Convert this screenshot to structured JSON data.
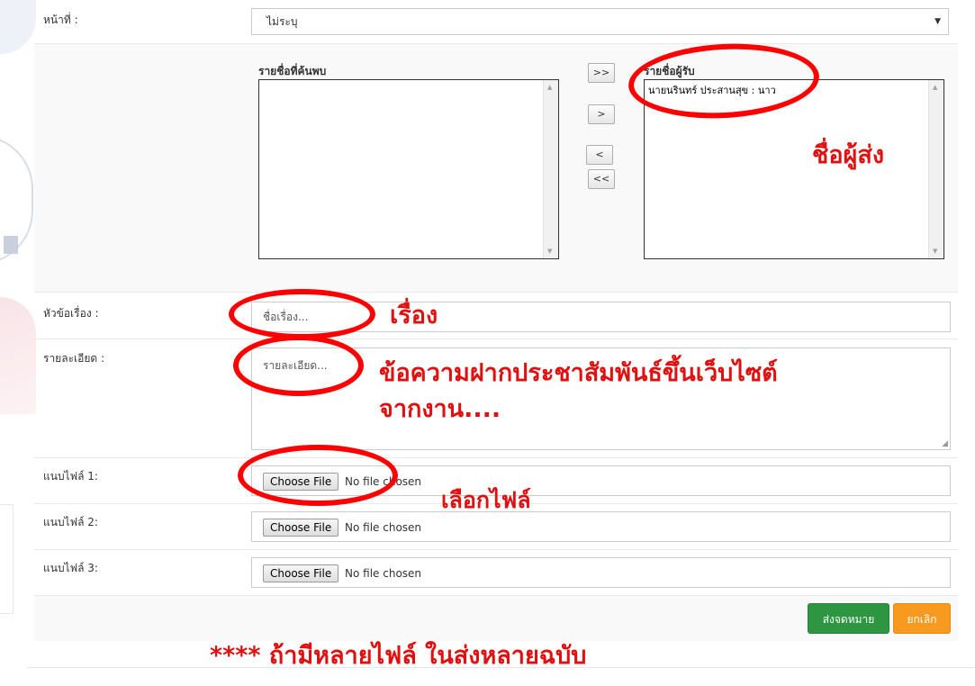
{
  "form": {
    "department_label": "หน้าที่ :",
    "department_value": "ไม่ระบุ",
    "found_list_label": "รายชื่อที่ค้นพบ",
    "found_list_items": [],
    "recipient_list_label": "รายชื่อผู้รับ",
    "recipient_list_items": [
      "นายนรินทร์ ประสานสุข : นาว"
    ],
    "move_buttons": [
      ">>",
      ">",
      "<",
      "<<"
    ],
    "subject_label": "หัวข้อเรื่อง :",
    "subject_placeholder": "ชื่อเรื่อง...",
    "detail_label": "รายละเอียด :",
    "detail_placeholder": "รายละเอียด...",
    "attachments": [
      {
        "label": "แนบไฟล์ 1:",
        "button": "Choose File",
        "status": "No file chosen"
      },
      {
        "label": "แนบไฟล์ 2:",
        "button": "Choose File",
        "status": "No file chosen"
      },
      {
        "label": "แนบไฟล์ 3:",
        "button": "Choose File",
        "status": "No file chosen"
      }
    ],
    "send_button": "ส่งจดหมาย",
    "cancel_button": "ยกเลิก"
  },
  "annotations": {
    "sender": "ชื่อผู้ส่ง",
    "subject": "เรื่อง",
    "detail_line1": "ข้อความฝากประชาสัมพันธ์ขึ้นเว็บไซต์",
    "detail_line2": "จากงาน....",
    "choose_file": "เลือกไฟล์",
    "multi_file_note": "**** ถ้ามีหลายไฟล์ ในส่งหลายฉบับ"
  },
  "colors": {
    "annotation_red": "#e01010",
    "send_green": "#2e9641",
    "cancel_orange": "#f79a1f"
  }
}
